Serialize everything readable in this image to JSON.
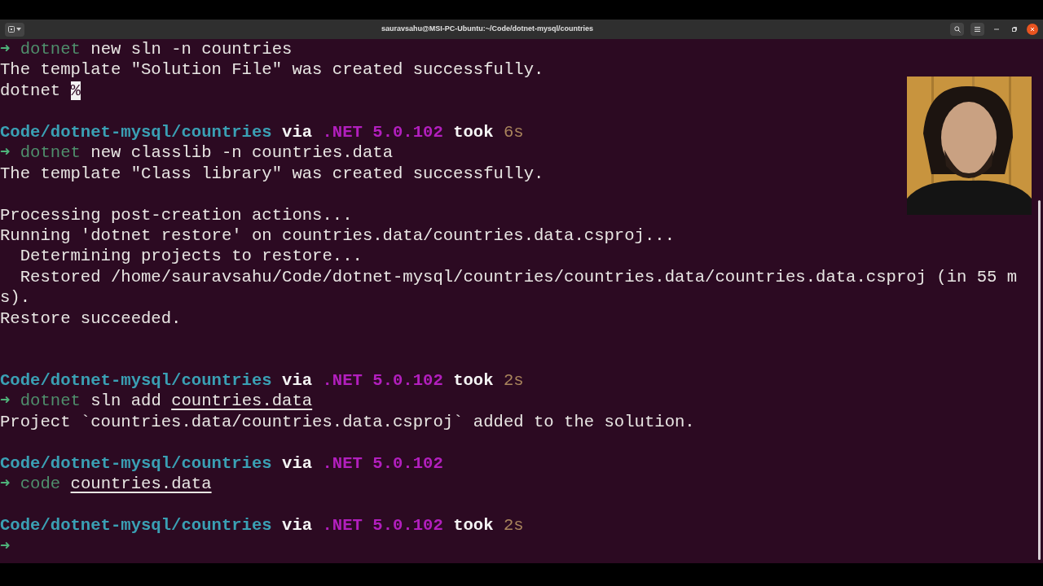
{
  "window": {
    "title": "sauravsahu@MSI-PC-Ubuntu:~/Code/dotnet-mysql/countries"
  },
  "lines": [
    {
      "kind": "command",
      "arrow": "➜",
      "program": "dotnet",
      "args": "new sln -n countries"
    },
    {
      "kind": "output",
      "text": "The template \"Solution File\" was created successfully."
    },
    {
      "kind": "output",
      "text": "dotnet",
      "cursor": "%"
    },
    {
      "kind": "blank"
    },
    {
      "kind": "prompt",
      "path": "Code/dotnet-mysql/countries",
      "via": "via",
      "runtime": ".NET 5.0.102",
      "took": "took",
      "duration": "6s"
    },
    {
      "kind": "command",
      "arrow": "➜",
      "program": "dotnet",
      "args": "new classlib -n countries.data"
    },
    {
      "kind": "output",
      "text": "The template \"Class library\" was created successfully."
    },
    {
      "kind": "blank"
    },
    {
      "kind": "output",
      "text": "Processing post-creation actions..."
    },
    {
      "kind": "output",
      "text": "Running 'dotnet restore' on countries.data/countries.data.csproj..."
    },
    {
      "kind": "output",
      "text": "  Determining projects to restore..."
    },
    {
      "kind": "output",
      "text": "  Restored /home/sauravsahu/Code/dotnet-mysql/countries/countries.data/countries.data.csproj (in 55 m"
    },
    {
      "kind": "output",
      "text": "s)."
    },
    {
      "kind": "output",
      "text": "Restore succeeded."
    },
    {
      "kind": "blank"
    },
    {
      "kind": "blank"
    },
    {
      "kind": "prompt",
      "path": "Code/dotnet-mysql/countries",
      "via": "via",
      "runtime": ".NET 5.0.102",
      "took": "took",
      "duration": "2s"
    },
    {
      "kind": "command",
      "arrow": "➜",
      "program": "dotnet",
      "args": "sln add",
      "target": "countries.data"
    },
    {
      "kind": "output",
      "text": "Project `countries.data/countries.data.csproj` added to the solution."
    },
    {
      "kind": "blank"
    },
    {
      "kind": "prompt",
      "path": "Code/dotnet-mysql/countries",
      "via": "via",
      "runtime": ".NET 5.0.102"
    },
    {
      "kind": "command",
      "arrow": "➜",
      "program": "code",
      "target": "countries.data"
    },
    {
      "kind": "blank"
    },
    {
      "kind": "prompt",
      "path": "Code/dotnet-mysql/countries",
      "via": "via",
      "runtime": ".NET 5.0.102",
      "took": "took",
      "duration": "2s"
    },
    {
      "kind": "command",
      "arrow": "➜"
    }
  ]
}
